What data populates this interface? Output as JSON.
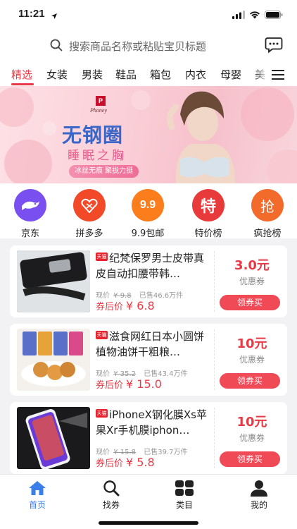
{
  "status": {
    "time": "11:21"
  },
  "search": {
    "placeholder": "搜索商品名称或粘贴宝贝标题"
  },
  "tabs": [
    {
      "label": "精选"
    },
    {
      "label": "女装"
    },
    {
      "label": "男装"
    },
    {
      "label": "鞋品"
    },
    {
      "label": "箱包"
    },
    {
      "label": "内衣"
    },
    {
      "label": "母婴"
    },
    {
      "label": "美"
    }
  ],
  "banner": {
    "brand_logo": "P",
    "brand_name": "Phoney",
    "headline": "无钢圈",
    "subheadline": "睡眠之胸",
    "tagline": "冰丝无痕  聚拢力挺"
  },
  "quick_links": [
    {
      "label": "京东",
      "icon": "jd-icon",
      "color": "#7a4ff0"
    },
    {
      "label": "拼多多",
      "icon": "pinduoduo-icon",
      "color": "#f24a28"
    },
    {
      "label": "9.9包邮",
      "icon": "nine-nine-icon",
      "color": "#fb7d1c",
      "glyph": "9.9"
    },
    {
      "label": "特价榜",
      "icon": "special-price-icon",
      "color": "#e83a3a",
      "glyph": "特"
    },
    {
      "label": "疯抢榜",
      "icon": "rush-icon",
      "color": "#f36b2a",
      "glyph": "抢"
    }
  ],
  "products": [
    {
      "badge": "天猫",
      "title": "纪梵保罗男士皮带真皮自动扣腰带韩…",
      "price_label": "现价",
      "price_currency": "¥",
      "price": "9.8",
      "sold": "已售46.6万件",
      "after_label": "券后价",
      "after_price": "¥ 6.8",
      "coupon": "3.0元",
      "coupon_label": "优惠券",
      "button": "领券买"
    },
    {
      "badge": "天猫",
      "title": "滋食网红日本小圆饼植物油饼干粗粮…",
      "price_label": "现价",
      "price_currency": "¥",
      "price": "35.2",
      "sold": "已售43.4万件",
      "after_label": "券后价",
      "after_price": "¥ 15.0",
      "coupon": "10元",
      "coupon_label": "优惠券",
      "button": "领券买"
    },
    {
      "badge": "天猫",
      "title": "iPhoneX钢化膜Xs苹果Xr手机膜iphon…",
      "price_label": "现价",
      "price_currency": "¥",
      "price": "15.8",
      "sold": "已售39.7万件",
      "after_label": "券后价",
      "after_price": "¥ 5.8",
      "coupon": "10元",
      "coupon_label": "优惠券",
      "button": "领券买"
    }
  ],
  "bottom_nav": [
    {
      "label": "首页",
      "icon": "home-icon",
      "active": true
    },
    {
      "label": "找券",
      "icon": "search-coupon-icon"
    },
    {
      "label": "类目",
      "icon": "category-icon"
    },
    {
      "label": "我的",
      "icon": "profile-icon"
    }
  ],
  "colors": {
    "accent": "#e83a46",
    "nav_active": "#3a7ee8"
  }
}
